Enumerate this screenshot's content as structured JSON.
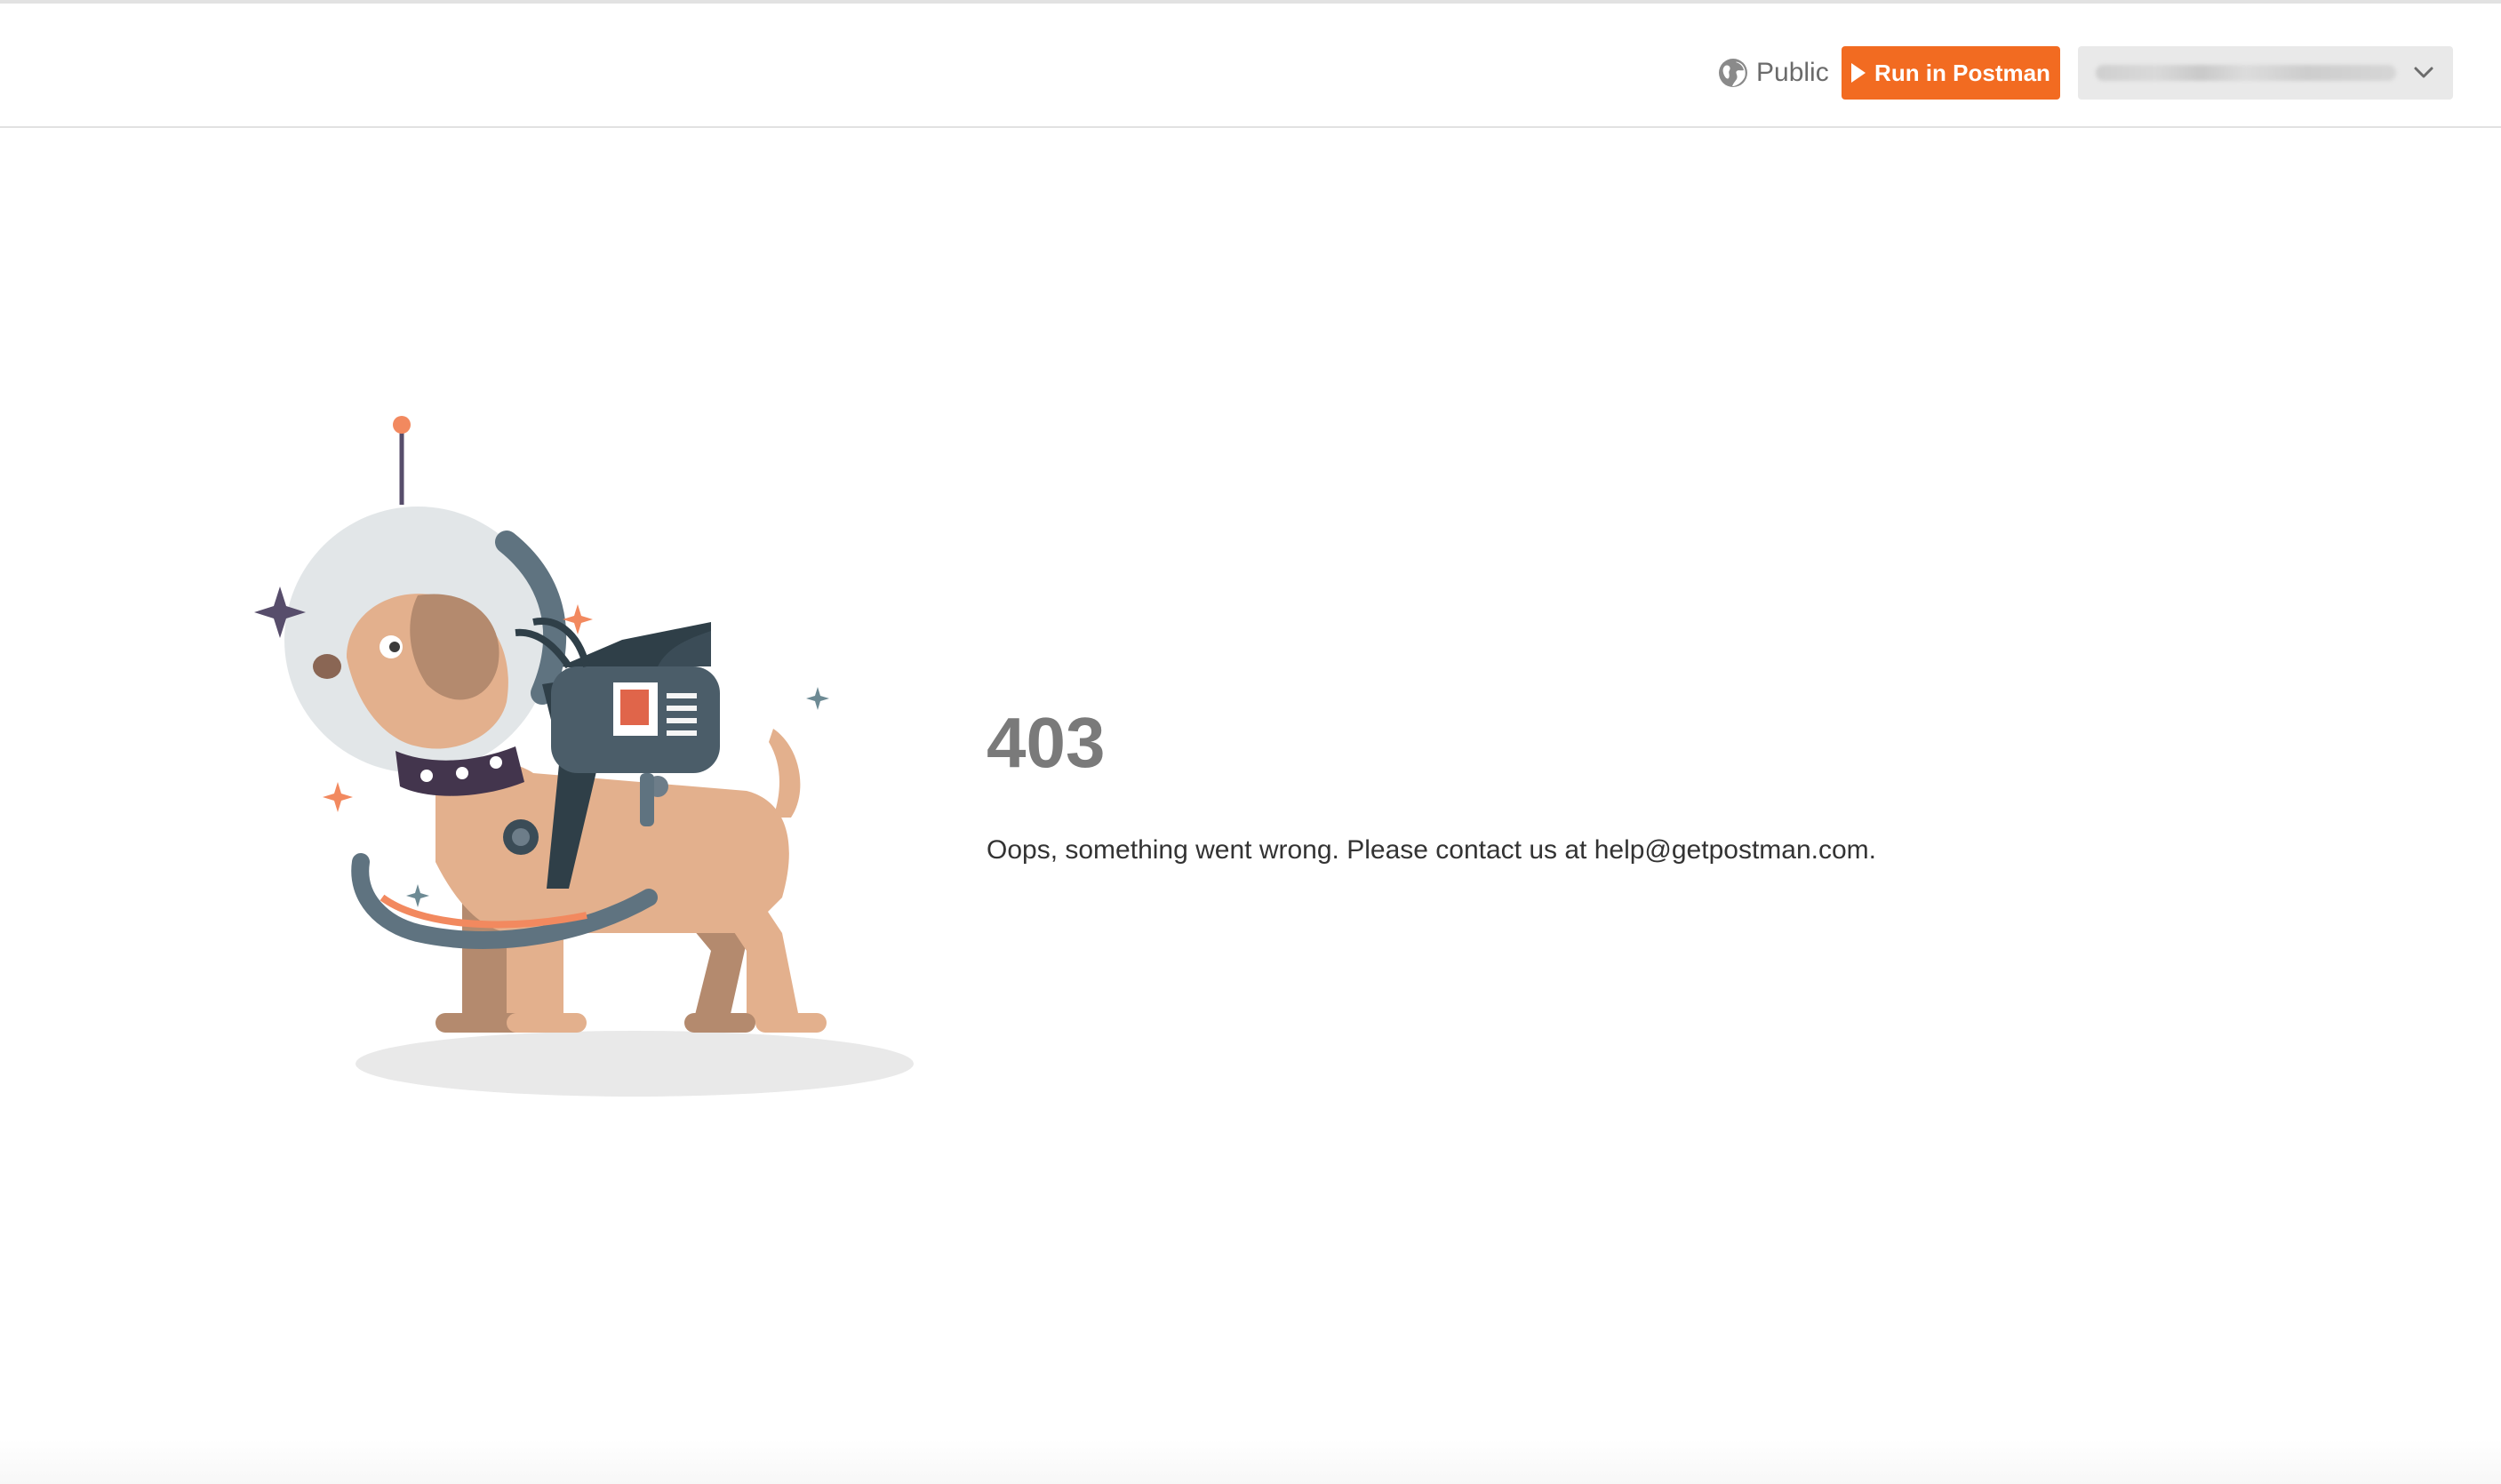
{
  "header": {
    "visibility_label": "Public",
    "run_button_label": "Run in Postman",
    "environment_select_value": ""
  },
  "error": {
    "code": "403",
    "message": "Oops, something went wrong. Please contact us at help@getpostman.com."
  },
  "icons": {
    "visibility": "globe-icon",
    "run": "play-icon",
    "dropdown": "chevron-down-icon"
  },
  "colors": {
    "accent": "#f26b21",
    "error_code": "#7a7a7a",
    "message_text": "#333333"
  }
}
